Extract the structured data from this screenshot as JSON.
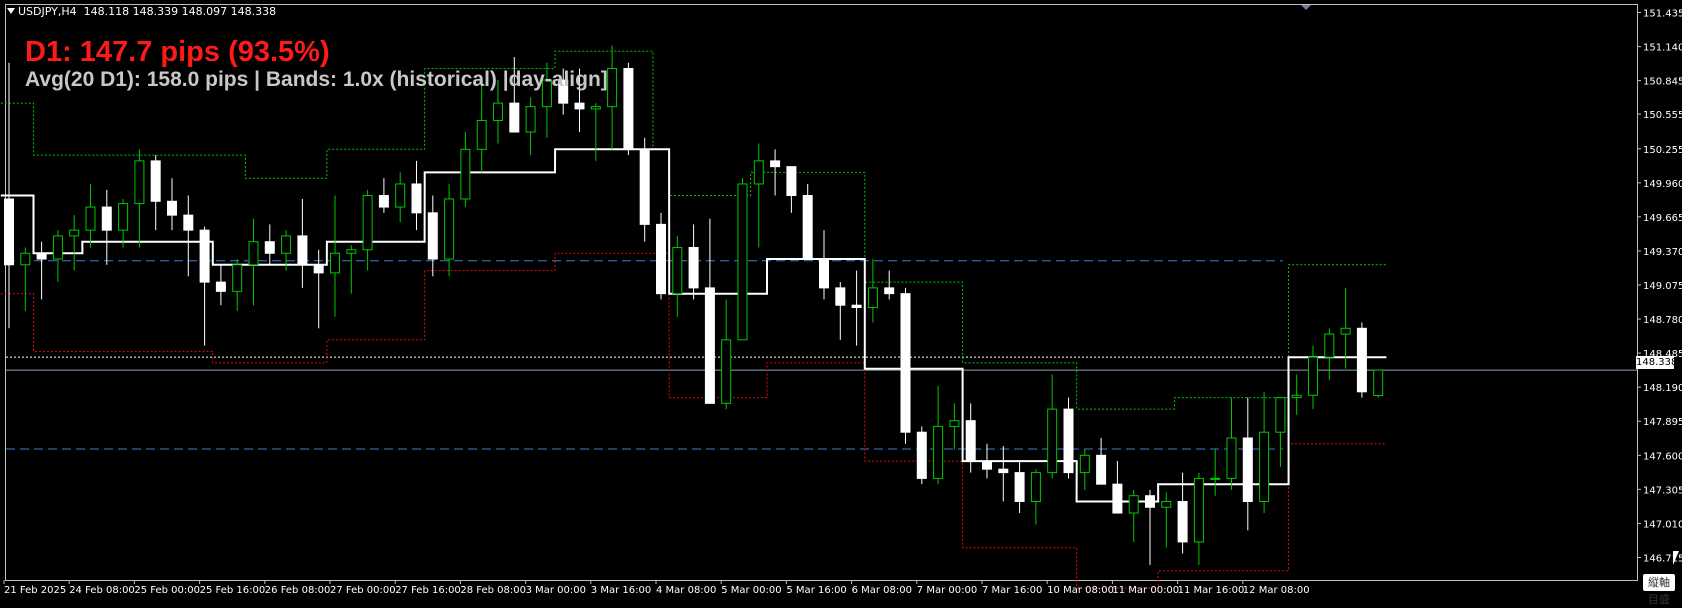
{
  "window": {
    "symbol_info": "USDJPY,H4",
    "ohlc": "148.118 148.339 148.097 148.338"
  },
  "overlay": {
    "headline": "D1: 147.7 pips (93.5%)",
    "subline": "Avg(20 D1): 158.0 pips | Bands: 1.0x (historical) |day-align]"
  },
  "current_price_label": "148.338",
  "corner_button": "縦軸目盛",
  "colors": {
    "background": "#000000",
    "bull_candle": "#00c800",
    "bear_candle": "#ffffff",
    "upper_band": "#00c800",
    "lower_band": "#e01010",
    "midline": "#ffffff",
    "level_lines": "#3a7fd5",
    "headline": "#ff1a1a",
    "subline": "#c8c8c8"
  },
  "chart_data": {
    "type": "candlestick",
    "ylim": [
      146.52,
      151.5
    ],
    "y_ticks": [
      "151.435",
      "151.140",
      "150.845",
      "150.555",
      "150.255",
      "149.960",
      "149.665",
      "149.370",
      "149.075",
      "148.780",
      "148.485",
      "148.190",
      "147.895",
      "147.600",
      "147.305",
      "147.010",
      "146.715"
    ],
    "y_tick_values": [
      151.435,
      151.14,
      150.845,
      150.555,
      150.255,
      149.96,
      149.665,
      149.37,
      149.075,
      148.78,
      148.485,
      148.19,
      147.895,
      147.6,
      147.305,
      147.01,
      146.715
    ],
    "x_labels": [
      "21 Feb 2025",
      "24 Feb 08:00",
      "25 Feb 00:00",
      "25 Feb 16:00",
      "26 Feb 08:00",
      "27 Feb 00:00",
      "27 Feb 16:00",
      "28 Feb 08:00",
      "3 Mar 00:00",
      "3 Mar 16:00",
      "4 Mar 08:00",
      "5 Mar 00:00",
      "5 Mar 16:00",
      "6 Mar 08:00",
      "7 Mar 00:00",
      "7 Mar 16:00",
      "10 Mar 08:00",
      "11 Mar 00:00",
      "11 Mar 16:00",
      "12 Mar 08:00"
    ],
    "x_label_bar_index": [
      0,
      4,
      8,
      12,
      16,
      20,
      24,
      28,
      32,
      36,
      40,
      44,
      48,
      52,
      56,
      60,
      64,
      68,
      72,
      76
    ],
    "current_price": 148.338,
    "level_lines": [
      149.285,
      147.655
    ],
    "dotted_level": 148.45,
    "candles": [
      [
        149.82,
        151.0,
        148.7,
        149.25
      ],
      [
        149.25,
        149.4,
        148.85,
        149.35
      ],
      [
        149.35,
        149.45,
        148.95,
        149.3
      ],
      [
        149.3,
        149.55,
        149.1,
        149.5
      ],
      [
        149.5,
        149.68,
        149.2,
        149.55
      ],
      [
        149.55,
        149.95,
        149.4,
        149.75
      ],
      [
        149.75,
        149.9,
        149.25,
        149.55
      ],
      [
        149.55,
        149.82,
        149.4,
        149.78
      ],
      [
        149.78,
        150.25,
        149.4,
        150.15
      ],
      [
        150.15,
        150.2,
        149.55,
        149.8
      ],
      [
        149.8,
        150.0,
        149.55,
        149.68
      ],
      [
        149.68,
        149.85,
        149.15,
        149.55
      ],
      [
        149.55,
        149.58,
        148.55,
        149.1
      ],
      [
        149.1,
        149.25,
        148.9,
        149.02
      ],
      [
        149.02,
        149.3,
        148.85,
        149.25
      ],
      [
        149.25,
        149.65,
        148.9,
        149.45
      ],
      [
        149.45,
        149.6,
        149.25,
        149.35
      ],
      [
        149.35,
        149.55,
        149.2,
        149.5
      ],
      [
        149.5,
        149.82,
        149.05,
        149.25
      ],
      [
        149.25,
        149.38,
        148.7,
        149.18
      ],
      [
        149.18,
        149.85,
        148.8,
        149.35
      ],
      [
        149.35,
        149.42,
        149.0,
        149.38
      ],
      [
        149.38,
        149.9,
        149.2,
        149.85
      ],
      [
        149.85,
        150.0,
        149.7,
        149.75
      ],
      [
        149.75,
        150.05,
        149.62,
        149.95
      ],
      [
        149.95,
        150.15,
        149.55,
        149.7
      ],
      [
        149.7,
        149.85,
        149.15,
        149.3
      ],
      [
        149.3,
        149.95,
        149.15,
        149.82
      ],
      [
        149.82,
        150.4,
        149.75,
        150.25
      ],
      [
        150.25,
        150.85,
        150.05,
        150.5
      ],
      [
        150.5,
        150.85,
        150.3,
        150.65
      ],
      [
        150.65,
        151.05,
        150.55,
        150.4
      ],
      [
        150.4,
        150.7,
        150.2,
        150.62
      ],
      [
        150.62,
        151.0,
        150.35,
        150.85
      ],
      [
        150.85,
        150.95,
        150.55,
        150.65
      ],
      [
        150.65,
        150.95,
        150.4,
        150.6
      ],
      [
        150.6,
        150.65,
        150.15,
        150.62
      ],
      [
        150.62,
        151.15,
        150.25,
        150.95
      ],
      [
        150.95,
        151.0,
        150.2,
        150.25
      ],
      [
        150.25,
        150.35,
        149.45,
        149.6
      ],
      [
        149.6,
        149.7,
        148.95,
        149.0
      ],
      [
        149.0,
        149.5,
        148.8,
        149.4
      ],
      [
        149.4,
        149.6,
        148.95,
        149.05
      ],
      [
        149.05,
        149.65,
        148.5,
        148.05
      ],
      [
        148.05,
        148.95,
        148.0,
        148.6
      ],
      [
        148.6,
        150.0,
        148.6,
        149.95
      ],
      [
        149.95,
        150.3,
        149.4,
        150.15
      ],
      [
        150.15,
        150.25,
        149.85,
        150.1
      ],
      [
        150.1,
        150.1,
        149.7,
        149.85
      ],
      [
        149.85,
        149.95,
        149.3,
        149.3
      ],
      [
        149.3,
        149.55,
        148.95,
        149.05
      ],
      [
        149.05,
        149.1,
        148.6,
        148.9
      ],
      [
        148.9,
        149.2,
        148.55,
        148.88
      ],
      [
        148.88,
        149.3,
        148.75,
        149.05
      ],
      [
        149.05,
        149.2,
        148.95,
        149.0
      ],
      [
        149.0,
        149.05,
        147.7,
        147.8
      ],
      [
        147.8,
        147.85,
        147.35,
        147.4
      ],
      [
        147.4,
        148.2,
        147.35,
        147.85
      ],
      [
        147.85,
        148.05,
        147.65,
        147.9
      ],
      [
        147.9,
        148.05,
        147.45,
        147.55
      ],
      [
        147.55,
        147.7,
        147.4,
        147.48
      ],
      [
        147.48,
        147.68,
        147.2,
        147.45
      ],
      [
        147.45,
        147.55,
        147.1,
        147.2
      ],
      [
        147.2,
        147.48,
        147.0,
        147.45
      ],
      [
        147.45,
        148.3,
        147.4,
        148.0
      ],
      [
        148.0,
        148.1,
        147.4,
        147.45
      ],
      [
        147.45,
        147.65,
        147.3,
        147.6
      ],
      [
        147.6,
        147.75,
        147.35,
        147.35
      ],
      [
        147.35,
        147.55,
        147.1,
        147.1
      ],
      [
        147.1,
        147.3,
        146.85,
        147.25
      ],
      [
        147.25,
        147.3,
        146.65,
        147.15
      ],
      [
        147.15,
        147.28,
        146.8,
        147.2
      ],
      [
        147.2,
        147.45,
        146.75,
        146.85
      ],
      [
        146.85,
        147.45,
        146.65,
        147.4
      ],
      [
        147.4,
        147.65,
        147.25,
        147.4
      ],
      [
        147.4,
        148.1,
        147.3,
        147.75
      ],
      [
        147.75,
        148.1,
        146.95,
        147.2
      ],
      [
        147.2,
        148.15,
        147.1,
        147.8
      ],
      [
        147.8,
        148.1,
        147.5,
        148.1
      ],
      [
        148.1,
        148.3,
        147.95,
        148.12
      ],
      [
        148.12,
        148.55,
        148.0,
        148.45
      ],
      [
        148.45,
        148.7,
        148.25,
        148.65
      ],
      [
        148.65,
        149.05,
        148.35,
        148.7
      ],
      [
        148.7,
        148.75,
        148.1,
        148.15
      ],
      [
        148.118,
        148.339,
        148.097,
        148.338
      ]
    ],
    "midline": [
      149.85,
      149.85,
      149.35,
      149.35,
      149.35,
      149.45,
      149.45,
      149.45,
      149.45,
      149.45,
      149.45,
      149.45,
      149.45,
      149.25,
      149.25,
      149.25,
      149.25,
      149.25,
      149.25,
      149.25,
      149.45,
      149.45,
      149.45,
      149.45,
      149.45,
      149.45,
      150.05,
      150.05,
      150.05,
      150.05,
      150.05,
      150.05,
      150.05,
      150.05,
      150.25,
      150.25,
      150.25,
      150.25,
      150.25,
      150.25,
      150.25,
      149.0,
      149.0,
      149.0,
      149.0,
      149.0,
      149.0,
      149.3,
      149.3,
      149.3,
      149.3,
      149.3,
      149.3,
      148.35,
      148.35,
      148.35,
      148.35,
      148.35,
      148.35,
      147.55,
      147.55,
      147.55,
      147.55,
      147.55,
      147.55,
      147.55,
      147.2,
      147.2,
      147.2,
      147.2,
      147.2,
      147.35,
      147.35,
      147.35,
      147.35,
      147.35,
      147.35,
      147.35,
      147.35,
      148.45,
      148.45,
      148.45,
      148.45,
      148.45,
      148.45
    ],
    "upper_band": [
      150.65,
      150.65,
      150.2,
      150.2,
      150.2,
      150.2,
      150.2,
      150.2,
      150.2,
      150.2,
      150.2,
      150.2,
      150.2,
      150.2,
      150.2,
      150.0,
      150.0,
      150.0,
      150.0,
      150.0,
      150.25,
      150.25,
      150.25,
      150.25,
      150.25,
      150.25,
      150.95,
      150.95,
      150.95,
      150.95,
      150.95,
      150.95,
      150.95,
      150.95,
      151.1,
      151.1,
      151.1,
      151.1,
      151.1,
      151.1,
      150.25,
      149.85,
      149.85,
      149.85,
      149.85,
      149.85,
      150.05,
      150.05,
      150.05,
      150.05,
      150.05,
      150.05,
      150.05,
      149.1,
      149.1,
      149.1,
      149.1,
      149.1,
      149.1,
      148.4,
      148.4,
      148.4,
      148.4,
      148.4,
      148.4,
      148.4,
      148.0,
      148.0,
      148.0,
      148.0,
      148.0,
      148.0,
      148.1,
      148.1,
      148.1,
      148.1,
      148.1,
      148.1,
      148.1,
      149.25,
      149.25,
      149.25,
      149.25,
      149.25,
      149.25
    ],
    "lower_band": [
      149.0,
      149.0,
      148.5,
      148.5,
      148.5,
      148.5,
      148.5,
      148.5,
      148.5,
      148.5,
      148.5,
      148.5,
      148.5,
      148.4,
      148.4,
      148.4,
      148.4,
      148.4,
      148.4,
      148.4,
      148.6,
      148.6,
      148.6,
      148.6,
      148.6,
      148.6,
      149.2,
      149.2,
      149.2,
      149.2,
      149.2,
      149.2,
      149.2,
      149.2,
      149.35,
      149.35,
      149.35,
      149.35,
      149.35,
      149.35,
      149.35,
      148.1,
      148.1,
      148.1,
      148.1,
      148.1,
      148.1,
      148.4,
      148.4,
      148.4,
      148.4,
      148.4,
      148.4,
      147.55,
      147.55,
      147.55,
      147.55,
      147.55,
      147.55,
      146.8,
      146.8,
      146.8,
      146.8,
      146.8,
      146.8,
      146.8,
      146.45,
      146.45,
      146.45,
      146.45,
      146.45,
      146.6,
      146.6,
      146.6,
      146.6,
      146.6,
      146.6,
      146.6,
      146.6,
      147.7,
      147.7,
      147.7,
      147.7,
      147.7,
      147.7
    ]
  }
}
